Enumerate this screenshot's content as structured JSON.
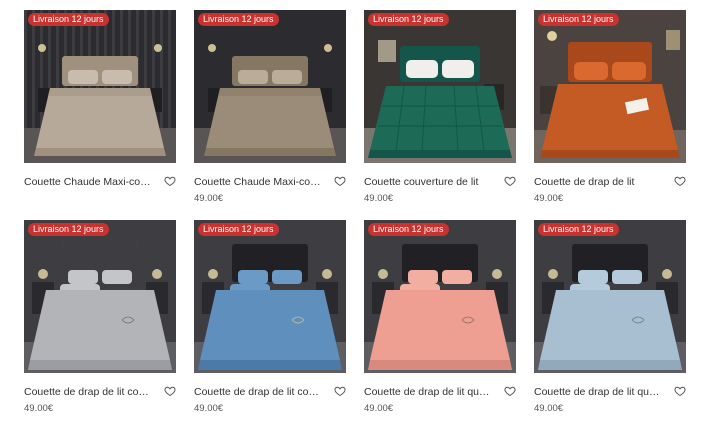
{
  "products": [
    {
      "badge": "Livraison 12 jours",
      "title": "Couette Chaude Maxi-confort",
      "price": "",
      "wall": "#2b2b30",
      "duvet": "#b7a999",
      "duvet_dark": "#a0917f",
      "pillow": "#c8bcae",
      "floor": "#5a5555",
      "icon": "heart-icon"
    },
    {
      "badge": "Livraison 12 jours",
      "title": "Couette Chaude Maxi-confort",
      "price": "49.00€",
      "wall": "#2b2b30",
      "duvet": "#9a8c78",
      "duvet_dark": "#857761",
      "pillow": "#b9ac98",
      "floor": "#5a5555",
      "icon": "heart-icon"
    },
    {
      "badge": "Livraison 12 jours",
      "title": "Couette couverture de lit",
      "price": "49.00€",
      "wall": "#3a3634",
      "duvet": "#1d6a57",
      "duvet_dark": "#15564a",
      "pillow": "#f0efec",
      "floor": "#7b7570",
      "icon": "heart-icon"
    },
    {
      "badge": "Livraison 12 jours",
      "title": "Couette de drap de lit",
      "price": "49.00€",
      "wall": "#4a4340",
      "duvet": "#c45a24",
      "duvet_dark": "#a9491b",
      "pillow": "#d9692f",
      "floor": "#6e655f",
      "icon": "heart-icon"
    },
    {
      "badge": "Livraison 12 jours",
      "title": "Couette de drap de lit couleur...",
      "price": "49.00€",
      "wall": "#3d3d42",
      "duvet": "#b3b4b8",
      "duvet_dark": "#9c9da2",
      "pillow": "#c4c5c9",
      "floor": "#5d5d62",
      "icon": "heart-icon"
    },
    {
      "badge": "Livraison 12 jours",
      "title": "Couette de drap de lit couleur...",
      "price": "49.00€",
      "wall": "#3d3d42",
      "duvet": "#5f8fbd",
      "duvet_dark": "#4c7aa7",
      "pillow": "#6c9ac6",
      "floor": "#5d5d62",
      "icon": "heart-icon"
    },
    {
      "badge": "Livraison 12 jours",
      "title": "Couette de drap de lit quatre ...",
      "price": "49.00€",
      "wall": "#3d3d42",
      "duvet": "#ee9f92",
      "duvet_dark": "#d88a7e",
      "pillow": "#f3aea2",
      "floor": "#5d5d62",
      "icon": "heart-icon"
    },
    {
      "badge": "Livraison 12 jours",
      "title": "Couette de drap de lit quatre ...",
      "price": "49.00€",
      "wall": "#3d3d42",
      "duvet": "#a8bfd2",
      "duvet_dark": "#92a9bd",
      "pillow": "#b5cadb",
      "floor": "#5d5d62",
      "icon": "heart-icon"
    }
  ]
}
